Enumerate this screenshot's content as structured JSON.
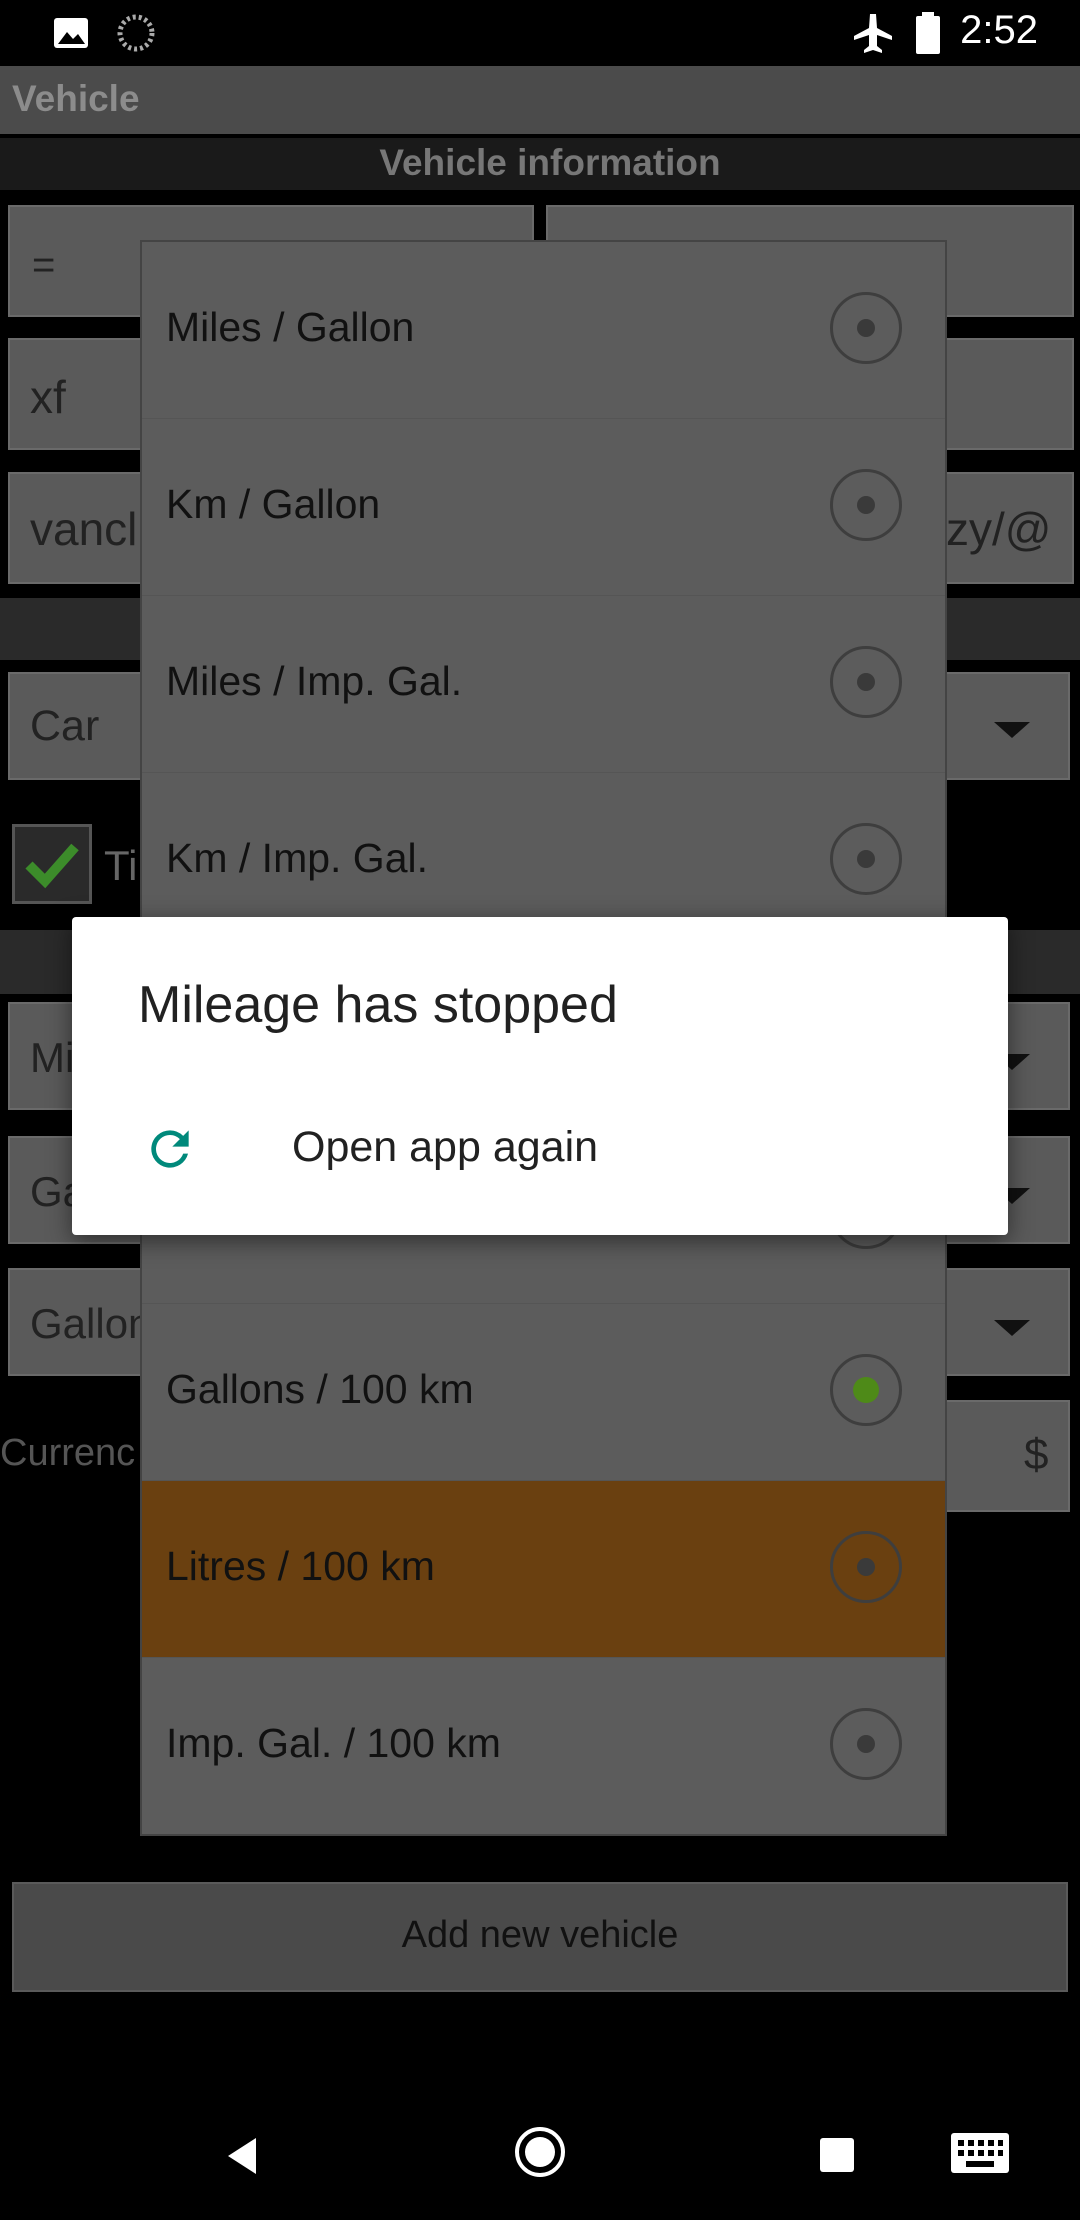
{
  "status_bar": {
    "time": "2:52",
    "icons": [
      "image-icon",
      "loading-icon",
      "airplane-icon",
      "battery-icon"
    ]
  },
  "app": {
    "title": "Vehicle",
    "section_title": "Vehicle information"
  },
  "background_form": {
    "fields": [
      {
        "value": "="
      },
      {
        "value": "xf"
      },
      {
        "value": "vancl"
      },
      {
        "value": "zy/@"
      },
      {
        "value": "Car"
      },
      {
        "value": "Ti"
      },
      {
        "value": "Mi"
      },
      {
        "value": "Ga"
      },
      {
        "value": "Gallon"
      },
      {
        "value": "$"
      }
    ],
    "currency_label": "Currenc",
    "add_button": "Add new vehicle"
  },
  "picker": {
    "options": [
      {
        "label": "Miles / Gallon",
        "selected": false
      },
      {
        "label": "Km / Gallon",
        "selected": false
      },
      {
        "label": "Miles / Imp. Gal.",
        "selected": false
      },
      {
        "label": "Km / Imp. Gal.",
        "selected": false
      },
      {
        "label": "Gallons / 100 km",
        "selected": true
      },
      {
        "label": "Litres / 100 km",
        "selected": false,
        "highlighted": true
      },
      {
        "label": "Imp. Gal. / 100 km",
        "selected": false
      }
    ]
  },
  "dialog": {
    "title": "Mileage has stopped",
    "action_label": "Open app again",
    "action_icon": "refresh-icon",
    "accent_color": "#00897b"
  },
  "nav_bar": {
    "icons": [
      "back-icon",
      "home-icon",
      "recents-icon",
      "keyboard-icon"
    ]
  }
}
